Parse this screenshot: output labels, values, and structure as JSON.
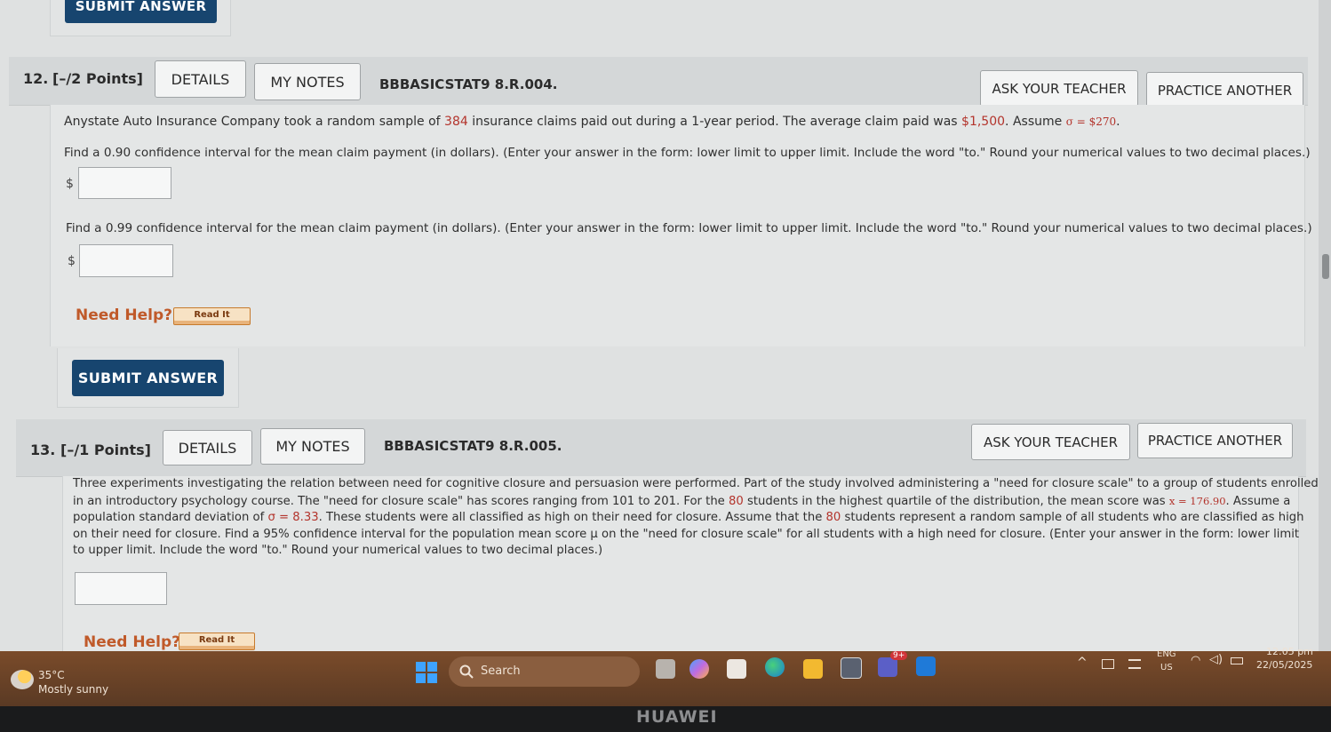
{
  "top": {
    "submit_label": "SUBMIT ANSWER"
  },
  "q12": {
    "number": "12.",
    "points": "[–/2 Points]",
    "details_label": "DETAILS",
    "notes_label": "MY NOTES",
    "code": "BBBASICSTAT9 8.R.004.",
    "ask_label": "ASK YOUR TEACHER",
    "practice_label": "PRACTICE ANOTHER",
    "intro_a": "Anystate Auto Insurance Company took a random sample of ",
    "intro_n": "384",
    "intro_b": " insurance claims paid out during a 1-year period. The average claim paid was ",
    "intro_mean": "$1,500",
    "intro_c": ". Assume ",
    "intro_sigma": "σ = $270",
    "intro_d": ".",
    "part1": "Find a 0.90 confidence interval for the mean claim payment (in dollars). (Enter your answer in the form: lower limit to upper limit. Include the word \"to.\" Round your numerical values to two decimal places.)",
    "part2": "Find a 0.99 confidence interval for the mean claim payment (in dollars). (Enter your answer in the form: lower limit to upper limit. Include the word \"to.\" Round your numerical values to two decimal places.)",
    "dollar": "$",
    "answer1_value": "",
    "answer2_value": "",
    "need_help": "Need Help?",
    "read_it": "Read It",
    "submit_label": "SUBMIT ANSWER"
  },
  "q13": {
    "number": "13.",
    "points": "[–/1 Points]",
    "details_label": "DETAILS",
    "notes_label": "MY NOTES",
    "code": "BBBASICSTAT9 8.R.005.",
    "ask_label": "ASK YOUR TEACHER",
    "practice_label": "PRACTICE ANOTHER",
    "line1": "Three experiments investigating the relation between need for cognitive closure and persuasion were performed. Part of the study involved administering a \"need for closure scale\" to a group of students enrolled",
    "line2a": "in an introductory psychology course. The \"need for closure scale\" has scores ranging from 101 to 201. For the ",
    "line2n": "80",
    "line2b": " students in the highest quartile of the distribution, the mean score was ",
    "line2x": "x = 176.90",
    "line2c": ". Assume a",
    "line3a": "population standard deviation of ",
    "line3s": "σ = 8.33",
    "line3b": ". These students were all classified as high on their need for closure. Assume that the ",
    "line3n": "80",
    "line3c": " students represent a random sample of all students who are classified as high",
    "line4": "on their need for closure. Find a 95% confidence interval for the population mean score μ on the \"need for closure scale\" for all students with a high need for closure. (Enter your answer in the form: lower limit",
    "line5": "to upper limit. Include the word \"to.\" Round your numerical values to two decimal places.)",
    "answer_value": "",
    "need_help": "Need Help?",
    "read_it": "Read It"
  },
  "taskbar": {
    "weather_temp": "35°C",
    "weather_desc": "Mostly sunny",
    "search_label": "Search",
    "lang_top": "ENG",
    "lang_bottom": "US",
    "time": "12:05 pm",
    "date": "22/05/2025",
    "badge": "9+"
  },
  "bezel": {
    "brand": "HUAWEI"
  },
  "colors": {
    "highlight": "#b3342c",
    "primary": "#17456f",
    "need_help": "#c05a2a"
  }
}
